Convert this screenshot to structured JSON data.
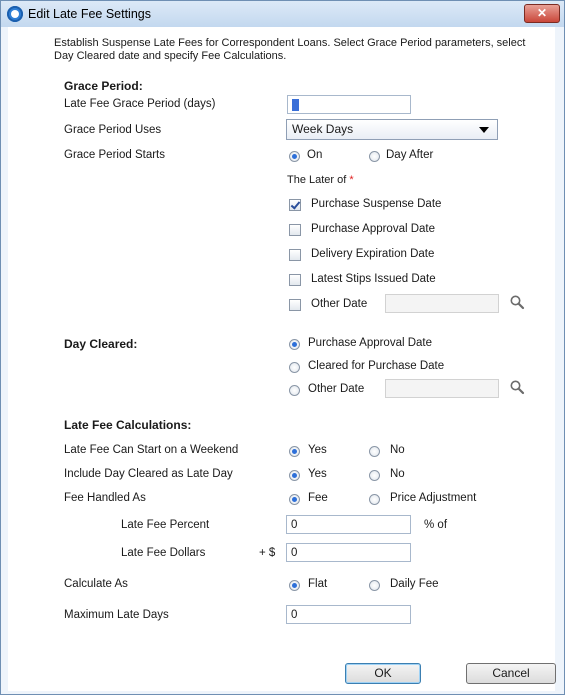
{
  "window": {
    "title": "Edit Late Fee Settings",
    "close_label": "✕"
  },
  "description": "Establish Suspense Late Fees for Correspondent Loans.  Select Grace Period parameters, select Day Cleared date and specify Fee Calculations.",
  "grace_period": {
    "section_label": "Grace Period:",
    "days_label": "Late Fee Grace Period (days)",
    "days_value": "0",
    "uses_label": "Grace Period Uses",
    "uses_value": "Week Days",
    "starts_label": "Grace Period Starts",
    "starts_on": "On",
    "starts_day_after": "Day After",
    "starts_selected": "On",
    "later_of_label": "The Later of",
    "required_mark": "*",
    "dates": [
      {
        "label": "Purchase Suspense Date",
        "checked": true
      },
      {
        "label": "Purchase Approval Date",
        "checked": false
      },
      {
        "label": "Delivery Expiration Date",
        "checked": false
      },
      {
        "label": "Latest Stips Issued Date",
        "checked": false
      },
      {
        "label": "Other Date",
        "checked": false
      }
    ],
    "other_date_value": ""
  },
  "day_cleared": {
    "section_label": "Day Cleared:",
    "options": [
      "Purchase Approval Date",
      "Cleared for Purchase Date",
      "Other Date"
    ],
    "selected": "Purchase Approval Date",
    "other_date_value": ""
  },
  "calculations": {
    "section_label": "Late Fee Calculations:",
    "weekend_label": "Late Fee Can Start on a Weekend",
    "weekend_yes": "Yes",
    "weekend_no": "No",
    "weekend_selected": "Yes",
    "include_label": "Include Day Cleared as Late Day",
    "include_yes": "Yes",
    "include_no": "No",
    "include_selected": "Yes",
    "handled_label": "Fee Handled As",
    "handled_fee": "Fee",
    "handled_price": "Price Adjustment",
    "handled_selected": "Fee",
    "percent_label": "Late Fee Percent",
    "percent_value": "0",
    "percent_of": "% of",
    "dollars_label": "Late Fee Dollars",
    "dollars_prefix": "+ $",
    "dollars_value": "0",
    "calc_as_label": "Calculate As",
    "calc_flat": "Flat",
    "calc_daily": "Daily Fee",
    "calc_selected": "Flat",
    "max_days_label": "Maximum Late Days",
    "max_days_value": "0"
  },
  "buttons": {
    "ok": "OK",
    "cancel": "Cancel"
  },
  "icons": {
    "window": "app-icon",
    "lookup": "magnifier-icon",
    "close": "close-icon"
  },
  "colors": {
    "accent": "#2d6fd9",
    "close_button": "#c9473a",
    "required": "#e02020"
  }
}
